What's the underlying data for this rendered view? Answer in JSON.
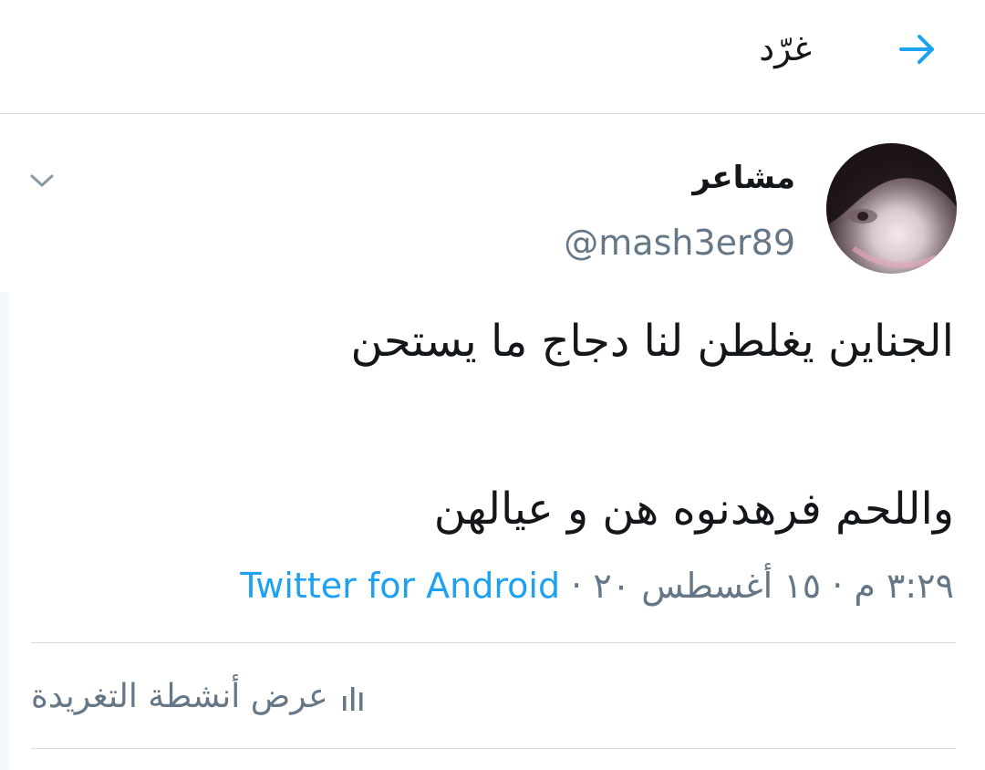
{
  "header": {
    "title": "غرّد",
    "back_icon": "arrow-right-icon",
    "accent_color": "#1da1f2"
  },
  "tweet": {
    "display_name": "مشاعر",
    "handle": "@mash3er89",
    "text_lines": [
      "الجناين يغلطن لنا دجاج ما يستحن",
      "واللحم فرهدنوه هن و عيالهن"
    ],
    "timestamp": "٣:٢٩ م · ١٥ أغسطس ٢٠",
    "separator": "·",
    "source": "Twitter for Android",
    "menu_icon": "chevron-down-icon"
  },
  "activity": {
    "label": "عرض أنشطة التغريدة",
    "icon": "bar-chart-icon"
  }
}
